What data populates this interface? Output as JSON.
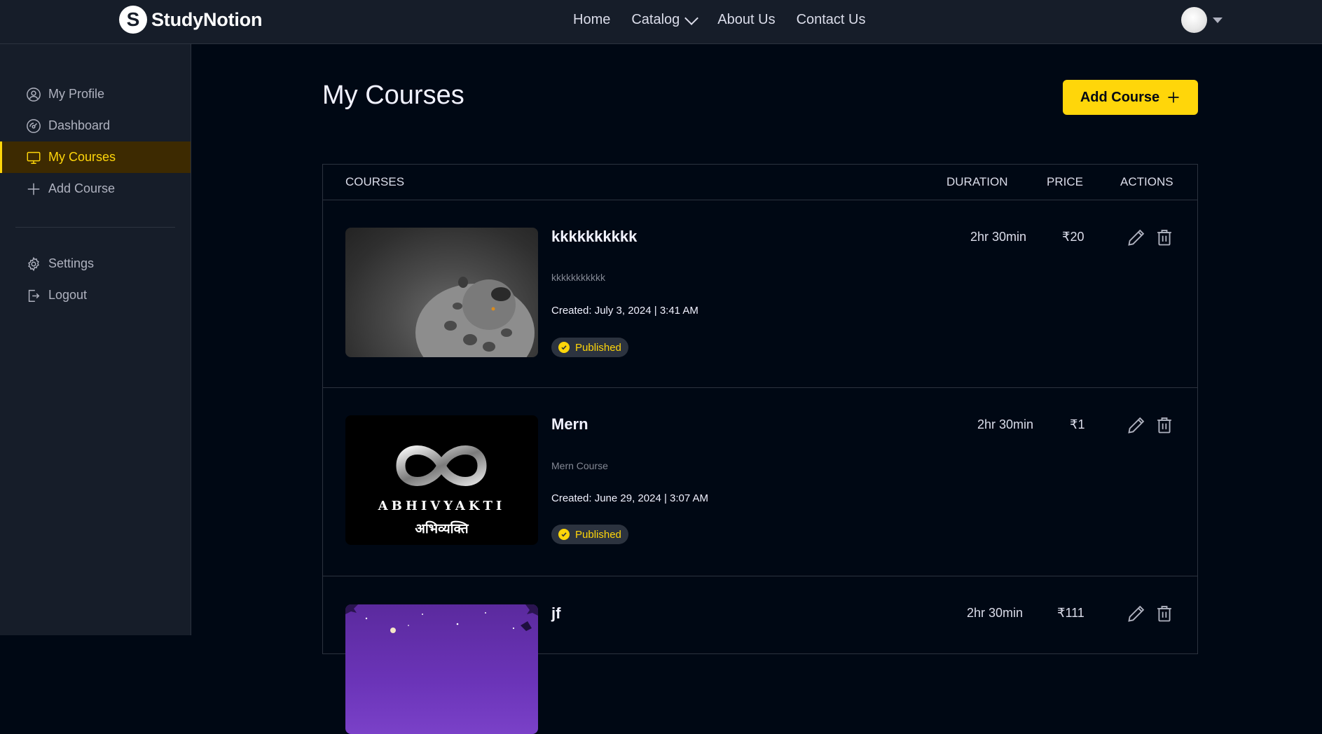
{
  "brand": {
    "name": "StudyNotion",
    "logo_letter": "S"
  },
  "nav": {
    "links": [
      {
        "label": "Home"
      },
      {
        "label": "Catalog"
      },
      {
        "label": "About Us"
      },
      {
        "label": "Contact Us"
      }
    ]
  },
  "sidebar": {
    "items": [
      {
        "label": "My Profile",
        "icon": "user-circle-icon"
      },
      {
        "label": "Dashboard",
        "icon": "gauge-icon"
      },
      {
        "label": "My Courses",
        "icon": "monitor-icon",
        "active": true
      },
      {
        "label": "Add Course",
        "icon": "plus-icon"
      }
    ],
    "bottom_items": [
      {
        "label": "Settings",
        "icon": "gear-icon"
      },
      {
        "label": "Logout",
        "icon": "logout-icon"
      }
    ]
  },
  "main": {
    "title": "My Courses",
    "add_button": {
      "label": "Add Course",
      "icon": "plus-icon"
    },
    "table": {
      "headers": {
        "courses": "COURSES",
        "duration": "DURATION",
        "price": "PRICE",
        "actions": "ACTIONS"
      },
      "rows": [
        {
          "title": "kkkkkkkkkk",
          "description": "kkkkkkkkkkk",
          "created": "Created: July 3, 2024 | 3:41 AM",
          "status": "Published",
          "duration": "2hr 30min",
          "price": "₹20"
        },
        {
          "title": "Mern",
          "description": "Mern Course",
          "created": "Created: June 29, 2024 | 3:07 AM",
          "status": "Published",
          "duration": "2hr 30min",
          "price": "₹1",
          "thumb_text": {
            "line1": "ABHIVYAKTI",
            "line2": "अभिव्यक्ति"
          }
        },
        {
          "title": "jf",
          "duration": "2hr 30min",
          "price": "₹111"
        }
      ]
    }
  },
  "colors": {
    "accent": "#ffd60a",
    "background": "#000814",
    "panel": "#161d29",
    "border": "#2c333f",
    "active_bg": "#3d2a01"
  }
}
